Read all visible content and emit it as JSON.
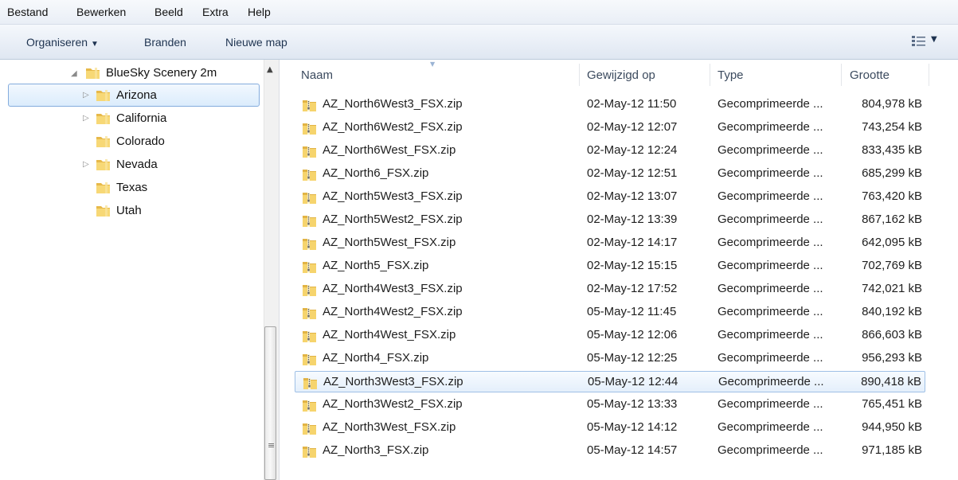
{
  "menu": [
    "Bestand",
    "Bewerken",
    "Beeld",
    "Extra",
    "Help"
  ],
  "toolbar": {
    "organize_label": "Organiseren",
    "organize_arrow": "▼",
    "burn_label": "Branden",
    "new_folder_label": "Nieuwe map",
    "view_icon": "details-view-icon",
    "view_arrow": "▼"
  },
  "nav": {
    "root": {
      "label": "BlueSky Scenery 2m",
      "expander": "◢"
    },
    "items": [
      {
        "label": "Arizona",
        "expander": "▷",
        "selected": true
      },
      {
        "label": "California",
        "expander": "▷"
      },
      {
        "label": "Colorado",
        "expander": ""
      },
      {
        "label": "Nevada",
        "expander": "▷"
      },
      {
        "label": "Texas",
        "expander": ""
      },
      {
        "label": "Utah",
        "expander": ""
      }
    ],
    "scroll_up": "▲",
    "grip": "≡"
  },
  "columns": {
    "name": "Naam",
    "date": "Gewijzigd op",
    "type": "Type",
    "size": "Grootte",
    "sort_indicator": "▼"
  },
  "files": [
    {
      "name": "AZ_North6West3_FSX.zip",
      "date": "02-May-12 11:50",
      "type": "Gecomprimeerde ...",
      "size": "804,978 kB"
    },
    {
      "name": "AZ_North6West2_FSX.zip",
      "date": "02-May-12 12:07",
      "type": "Gecomprimeerde ...",
      "size": "743,254 kB"
    },
    {
      "name": "AZ_North6West_FSX.zip",
      "date": "02-May-12 12:24",
      "type": "Gecomprimeerde ...",
      "size": "833,435 kB"
    },
    {
      "name": "AZ_North6_FSX.zip",
      "date": "02-May-12 12:51",
      "type": "Gecomprimeerde ...",
      "size": "685,299 kB"
    },
    {
      "name": "AZ_North5West3_FSX.zip",
      "date": "02-May-12 13:07",
      "type": "Gecomprimeerde ...",
      "size": "763,420 kB"
    },
    {
      "name": "AZ_North5West2_FSX.zip",
      "date": "02-May-12 13:39",
      "type": "Gecomprimeerde ...",
      "size": "867,162 kB"
    },
    {
      "name": "AZ_North5West_FSX.zip",
      "date": "02-May-12 14:17",
      "type": "Gecomprimeerde ...",
      "size": "642,095 kB"
    },
    {
      "name": "AZ_North5_FSX.zip",
      "date": "02-May-12 15:15",
      "type": "Gecomprimeerde ...",
      "size": "702,769 kB"
    },
    {
      "name": "AZ_North4West3_FSX.zip",
      "date": "02-May-12 17:52",
      "type": "Gecomprimeerde ...",
      "size": "742,021 kB"
    },
    {
      "name": "AZ_North4West2_FSX.zip",
      "date": "05-May-12 11:45",
      "type": "Gecomprimeerde ...",
      "size": "840,192 kB"
    },
    {
      "name": "AZ_North4West_FSX.zip",
      "date": "05-May-12 12:06",
      "type": "Gecomprimeerde ...",
      "size": "866,603 kB"
    },
    {
      "name": "AZ_North4_FSX.zip",
      "date": "05-May-12 12:25",
      "type": "Gecomprimeerde ...",
      "size": "956,293 kB"
    },
    {
      "name": "AZ_North3West3_FSX.zip",
      "date": "05-May-12 12:44",
      "type": "Gecomprimeerde ...",
      "size": "890,418 kB",
      "selected": true
    },
    {
      "name": "AZ_North3West2_FSX.zip",
      "date": "05-May-12 13:33",
      "type": "Gecomprimeerde ...",
      "size": "765,451 kB"
    },
    {
      "name": "AZ_North3West_FSX.zip",
      "date": "05-May-12 14:12",
      "type": "Gecomprimeerde ...",
      "size": "944,950 kB"
    },
    {
      "name": "AZ_North3_FSX.zip",
      "date": "05-May-12 14:57",
      "type": "Gecomprimeerde ...",
      "size": "971,185 kB"
    }
  ],
  "colors": {
    "folder": "#f2cc5c",
    "selection_border": "#84acdd",
    "selection_fill": "#dbecfc"
  }
}
